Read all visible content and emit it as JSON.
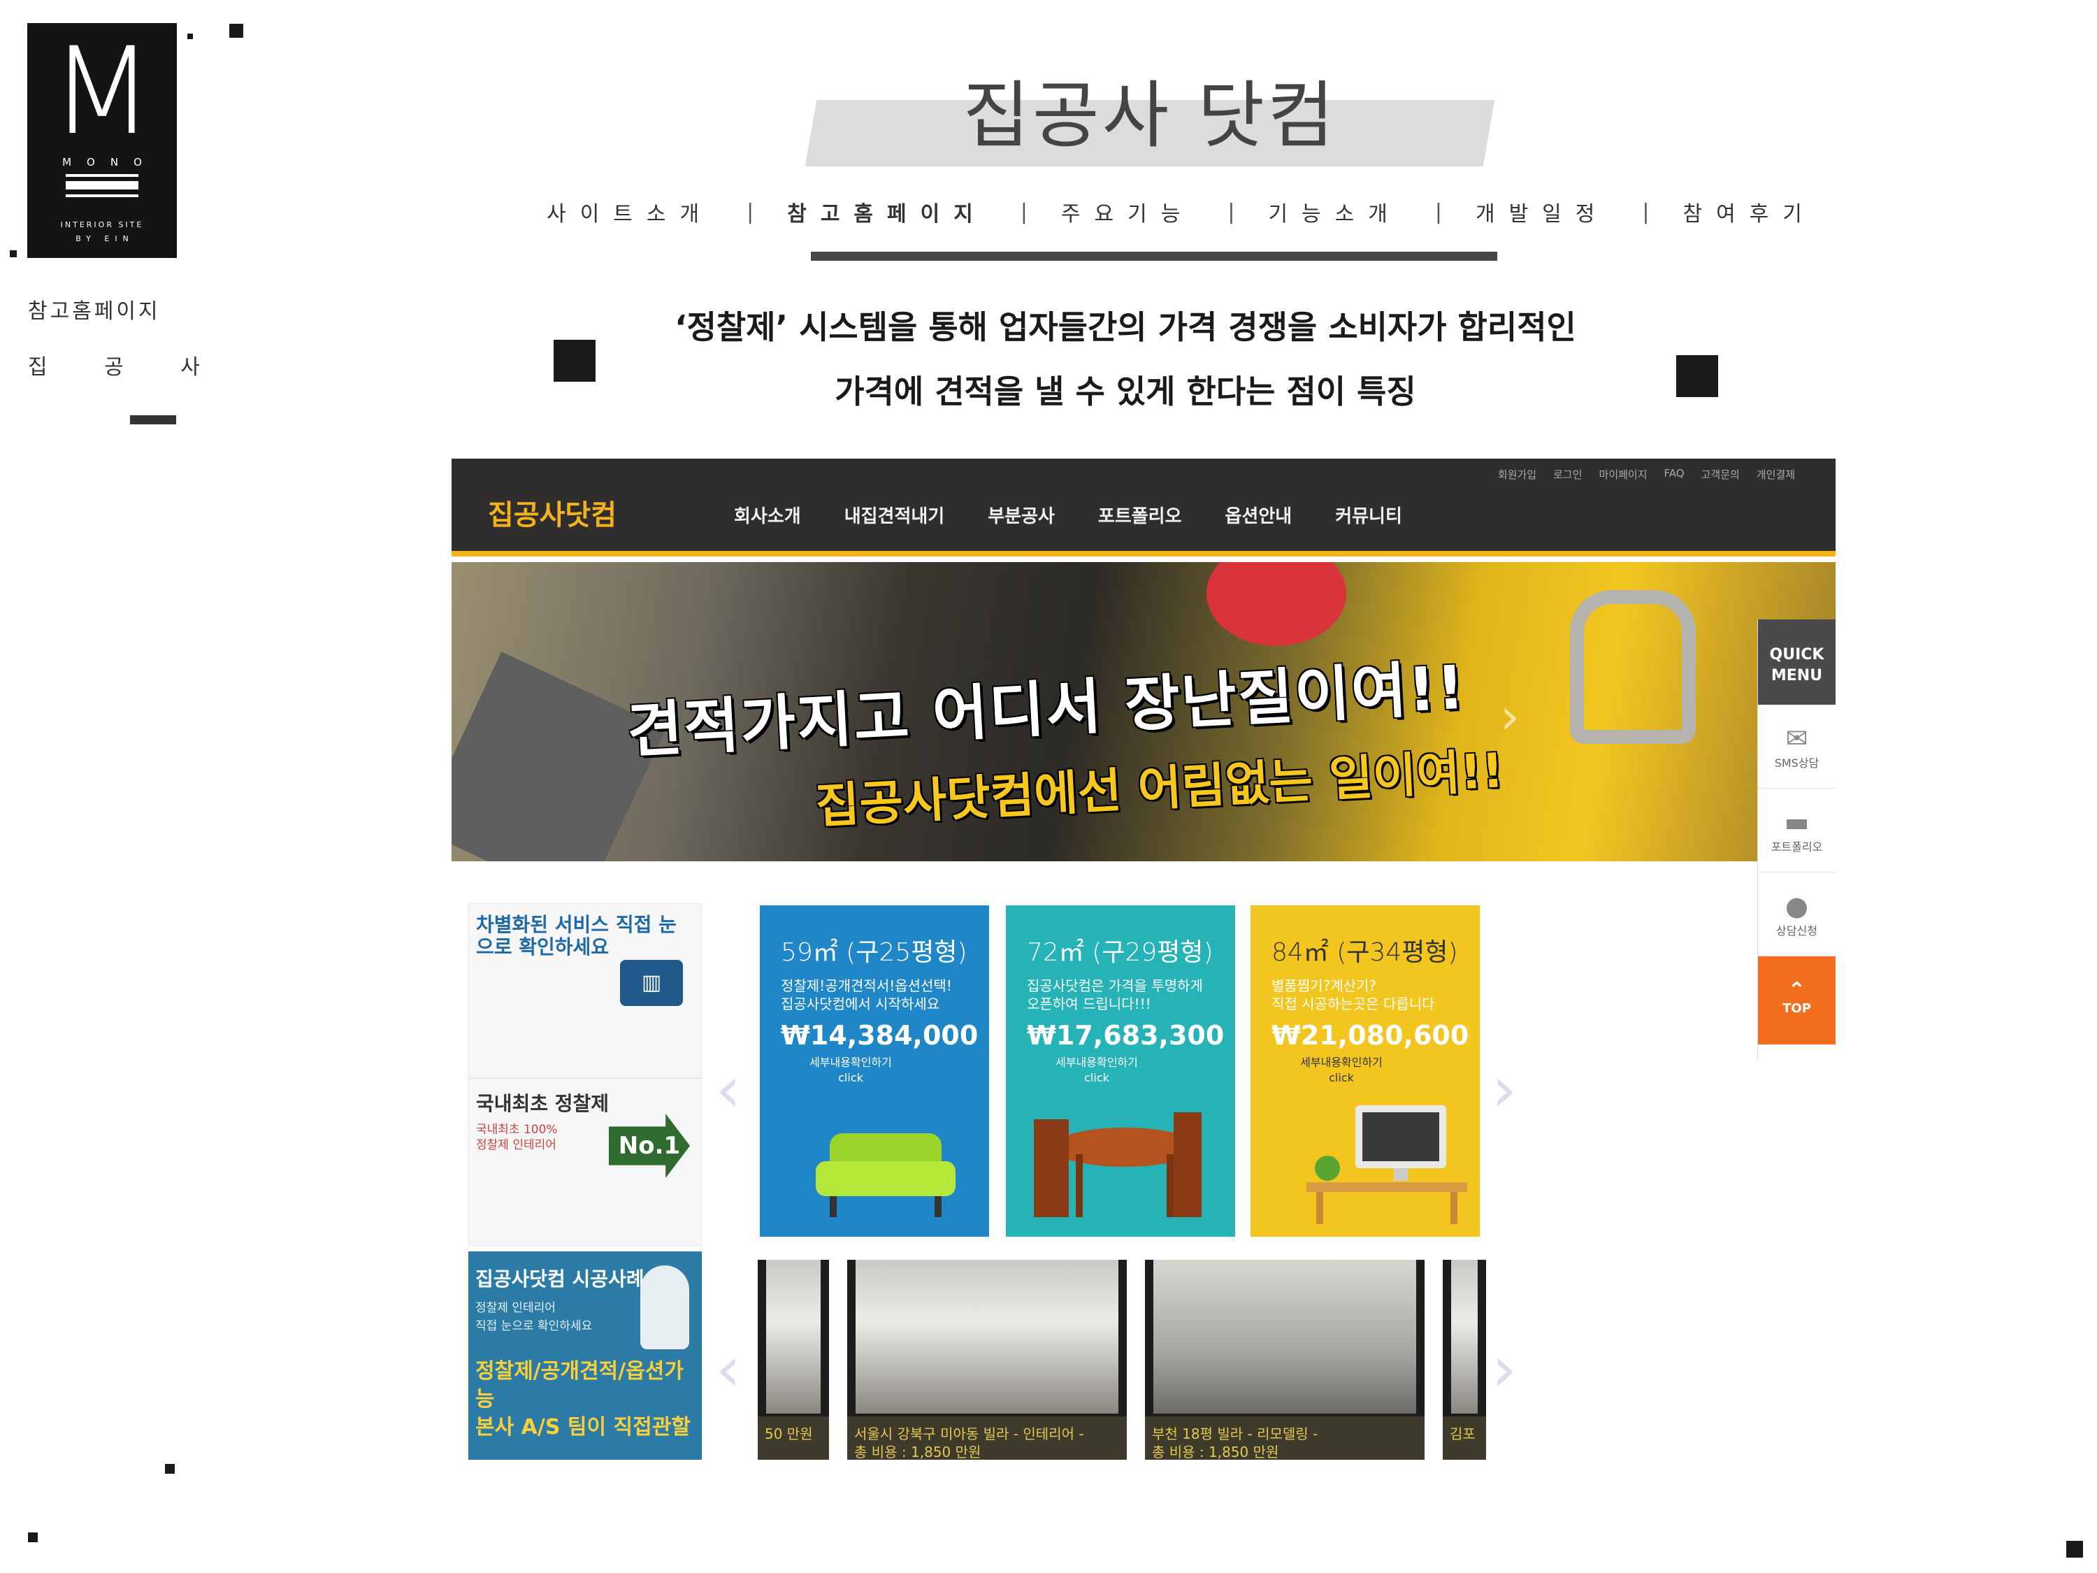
{
  "logo": {
    "letter": "M",
    "mono": "MONO",
    "sub1": "INTERIOR SITE",
    "sub2": "BY EIN"
  },
  "sidebar": {
    "section": "참고홈페이지",
    "name": "집 공 사"
  },
  "header": {
    "title": "집공사 닷컴",
    "nav": [
      {
        "label": "사이트소개"
      },
      {
        "label": "참고홈페이지"
      },
      {
        "label": "주요기능"
      },
      {
        "label": "기능소개"
      },
      {
        "label": "개발일정"
      },
      {
        "label": "참여후기"
      }
    ],
    "separator": "|"
  },
  "description": {
    "line1": "‘정찰제’ 시스템을 통해 업자들간의 가격 경쟁을 소비자가 합리적인",
    "line2": "가격에 견적을 낼 수 있게 한다는 점이 특징"
  },
  "screenshot": {
    "logo": "집공사닷컴",
    "util_links": [
      "회원가입",
      "로그인",
      "마이페이지",
      "FAQ",
      "고객문의",
      "개인결제"
    ],
    "menu": [
      "회사소개",
      "내집견적내기",
      "부분공사",
      "포트폴리오",
      "옵션안내",
      "커뮤니티"
    ],
    "banner": {
      "line1": "견적가지고 어디서 장난질이여!!",
      "line2": "집공사닷컴에선 어림없는 일이여!!"
    },
    "quick_menu": {
      "title1": "QUICK",
      "title2": "MENU",
      "items": [
        "SMS상담",
        "포트폴리오",
        "상담신청"
      ],
      "top": "TOP"
    },
    "promo": {
      "service_title": "차별화된 서비스 직접 눈으로 확인하세요",
      "first_title": "국내최초 정찰제",
      "first_sub1": "국내최초 100%",
      "first_sub2": "정찰제 인테리어",
      "badge": "No.1",
      "case_title": "집공사닷컴 시공사례",
      "case_sub1": "정찰제 인테리어",
      "case_sub2": "직접 눈으로 확인하세요",
      "case_yellow1": "정찰제/공개견적/옵션가능",
      "case_yellow2": "본사 A/S 팀이 직접관할"
    },
    "cards": [
      {
        "area": "59㎡ (구25평형)",
        "desc1": "정찰제!공개견적서!옵션선택!",
        "desc2": "집공사닷컴에서 시작하세요",
        "price": "₩14,384,000",
        "more": "세부내용확인하기",
        "click": "click",
        "color": "#1f86c8"
      },
      {
        "area": "72㎡ (구29평형)",
        "desc1": "집공사닷컴은 가격을 투명하게",
        "desc2": "오픈하여 드립니다!!!",
        "price": "₩17,683,300",
        "more": "세부내용확인하기",
        "click": "click",
        "color": "#25b3b8"
      },
      {
        "area": "84㎡ (구34평형)",
        "desc1": "별품찜기?계산기?",
        "desc2": "직접 시공하는곳은 다릅니다",
        "price": "₩21,080,600",
        "more": "세부내용확인하기",
        "click": "click",
        "color": "#f3c61f"
      }
    ],
    "gallery": [
      {
        "cap1": "",
        "cap2": "50 만원"
      },
      {
        "cap1": "서울시 강북구 미아동 빌라 - 인테리어 -",
        "cap2": "총 비용 : 1,850 만원"
      },
      {
        "cap1": "부천 18평 빌라 - 리모델링 -",
        "cap2": "총 비용 : 1,850 만원"
      },
      {
        "cap1": "김포",
        "cap2": ""
      }
    ]
  },
  "colors": {
    "accent": "#f0b419",
    "dark": "#2f2e2c",
    "quick_top": "#f46e1f"
  }
}
